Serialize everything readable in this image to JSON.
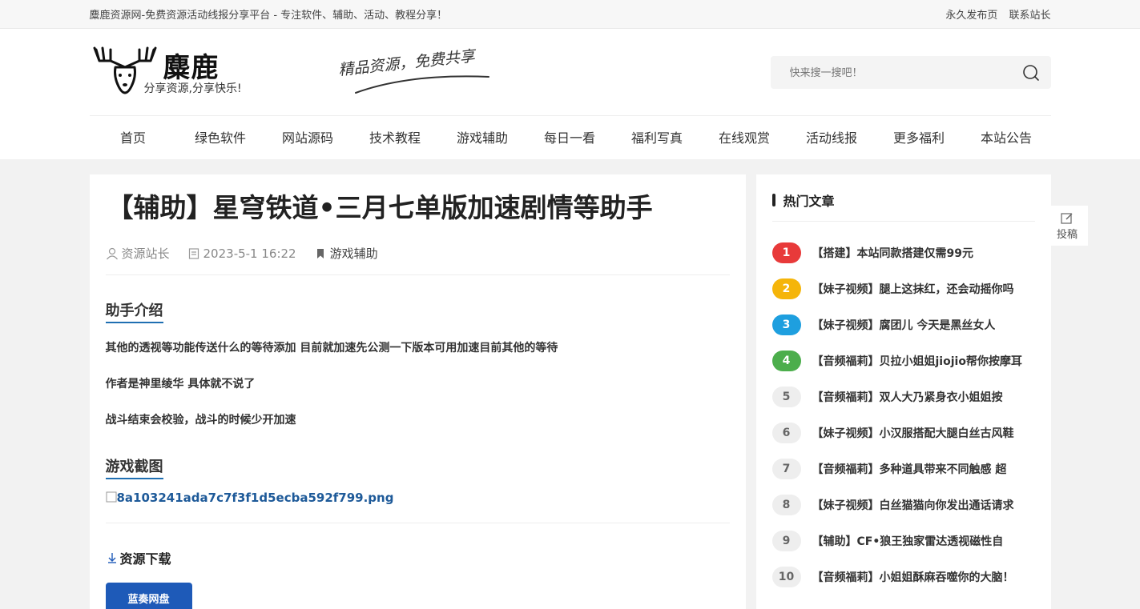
{
  "topbar": {
    "tagline": "麋鹿资源网-免费资源活动线报分享平台 - 专注软件、辅助、活动、教程分享！",
    "links": [
      "永久发布页",
      "联系站长"
    ]
  },
  "header": {
    "logo_text": "麋鹿",
    "logo_sub": "分享资源,分享快乐!",
    "slogan": "精品资源，免费共享",
    "search_placeholder": "快来搜一搜吧！"
  },
  "nav": [
    "首页",
    "绿色软件",
    "网站源码",
    "技术教程",
    "游戏辅助",
    "每日一看",
    "福利写真",
    "在线观赏",
    "活动线报",
    "更多福利",
    "本站公告"
  ],
  "post": {
    "title": "【辅助】星穹铁道•三月七单版加速剧情等助手",
    "author": "资源站长",
    "date": "2023-5-1 16:22",
    "category": "游戏辅助",
    "section1": "助手介绍",
    "p1": "其他的透视等功能传送什么的等待添加 目前就加速先公测一下版本可用加速目前其他的等待",
    "p2": "作者是神里绫华 具体就不说了",
    "p3": "战斗结束会校验，战斗的时候少开加速",
    "section2": "游戏截图",
    "image_alt": "8a103241ada7c7f3f1d5ecba592f799.png",
    "download_title": "资源下载",
    "download_button": "蓝奏网盘"
  },
  "sidebar": {
    "hot_title": "热门文章",
    "hot": [
      {
        "rank": "1",
        "title": "【搭建】本站同款搭建仅需99元"
      },
      {
        "rank": "2",
        "title": "【妹子视频】腿上这抹红，还会动摇你吗"
      },
      {
        "rank": "3",
        "title": "【妹子视频】腐团儿 今天是黑丝女人"
      },
      {
        "rank": "4",
        "title": "【音频福莉】贝拉小姐姐jiojio帮你按摩耳"
      },
      {
        "rank": "5",
        "title": "【音频福莉】双人大乃紧身衣小姐姐按"
      },
      {
        "rank": "6",
        "title": "【妹子视频】小汉服搭配大腿白丝古风鞋"
      },
      {
        "rank": "7",
        "title": "【音频福莉】多种道具带来不同触感 超"
      },
      {
        "rank": "8",
        "title": "【妹子视频】白丝猫猫向你发出通话请求"
      },
      {
        "rank": "9",
        "title": "【辅助】CF•狼王独家雷达透视磁性自"
      },
      {
        "rank": "10",
        "title": "【音频福莉】小姐姐酥麻吞噬你的大脑！"
      }
    ]
  },
  "float": {
    "submit_label": "投稿"
  }
}
